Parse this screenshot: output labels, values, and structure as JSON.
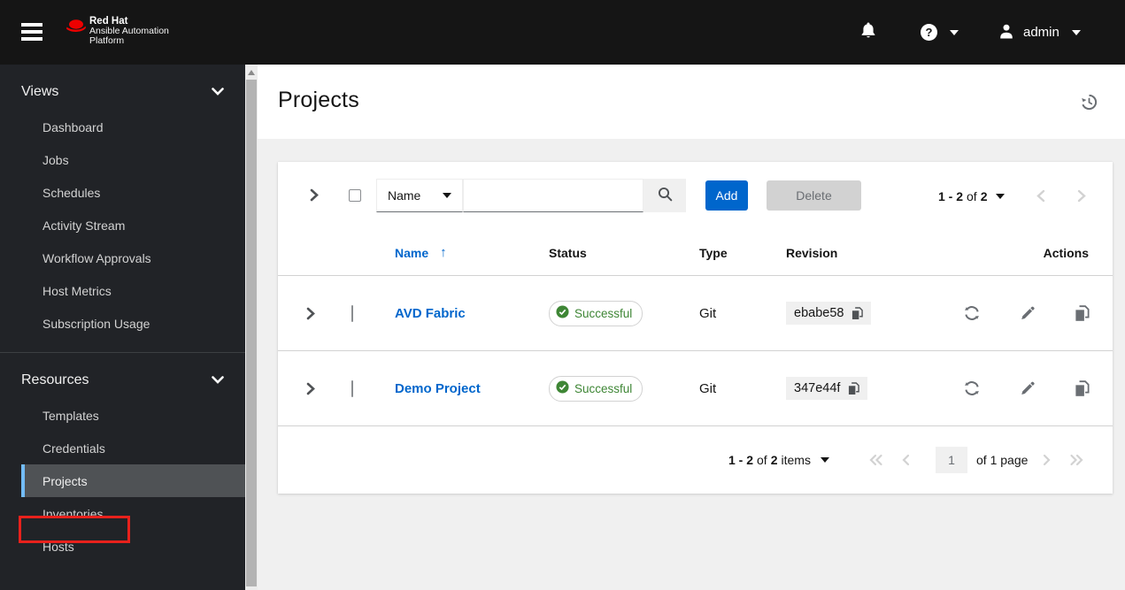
{
  "masthead": {
    "brand": {
      "title": "Red Hat",
      "subtitle_line1": "Ansible Automation",
      "subtitle_line2": "Platform"
    },
    "user_menu": {
      "username": "admin"
    }
  },
  "sidebar": {
    "groups": [
      {
        "label": "Views",
        "items": [
          {
            "label": "Dashboard"
          },
          {
            "label": "Jobs"
          },
          {
            "label": "Schedules"
          },
          {
            "label": "Activity Stream"
          },
          {
            "label": "Workflow Approvals"
          },
          {
            "label": "Host Metrics"
          },
          {
            "label": "Subscription Usage"
          }
        ]
      },
      {
        "label": "Resources",
        "items": [
          {
            "label": "Templates"
          },
          {
            "label": "Credentials"
          },
          {
            "label": "Projects",
            "selected": true
          },
          {
            "label": "Inventories",
            "annotated": true
          },
          {
            "label": "Hosts"
          }
        ]
      }
    ]
  },
  "page": {
    "title": "Projects"
  },
  "toolbar": {
    "filter": {
      "selected": "Name"
    },
    "search": {
      "value": "",
      "placeholder": ""
    },
    "buttons": {
      "add": "Add",
      "delete": "Delete"
    },
    "pagination": {
      "range": "1 - 2",
      "of_word": "of",
      "total": "2"
    }
  },
  "table": {
    "columns": {
      "name": "Name",
      "status": "Status",
      "type": "Type",
      "revision": "Revision",
      "actions": "Actions"
    },
    "sort": {
      "column": "Name",
      "direction": "ascending",
      "arrow": "↑"
    },
    "rows": [
      {
        "name": "AVD Fabric",
        "status": "Successful",
        "type": "Git",
        "revision": "ebabe58"
      },
      {
        "name": "Demo Project",
        "status": "Successful",
        "type": "Git",
        "revision": "347e44f"
      }
    ]
  },
  "footer_pagination": {
    "range": "1 - 2",
    "of_word": "of",
    "total": "2",
    "items_word": "items",
    "page_input": "1",
    "page_label": "of 1 page"
  },
  "icons": {
    "menu": "hamburger",
    "notifications": "bell",
    "help": "question-circle",
    "user": "person",
    "history": "clock-undo-arrow",
    "search": "magnifier",
    "status_ok": "check-circle-green",
    "copy": "two-pages",
    "sync": "circular-arrows",
    "edit": "pencil",
    "sort": "arrow-up"
  },
  "colors": {
    "masthead_bg": "#151515",
    "sidebar_bg": "#212327",
    "selected_bg": "#4f5255",
    "selected_indicator": "#73bcf7",
    "accent_blue": "#0066cc",
    "success_green": "#3e8635",
    "annotation_red": "#e8211c",
    "content_bg": "#f0f0f0",
    "border_grey": "#d2d2d2",
    "icon_grey": "#6a6e73"
  }
}
